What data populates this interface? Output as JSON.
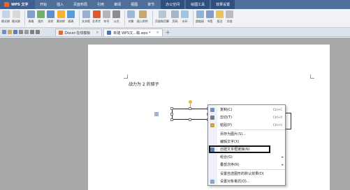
{
  "app": {
    "name": "WPS 文字"
  },
  "menu": [
    "开始",
    "插入",
    "页面布局",
    "引用",
    "审阅",
    "视图",
    "章节",
    "办公空间",
    "绘图工具",
    "效果设置"
  ],
  "menu_active_index": 7,
  "ribbon": {
    "group1": [
      "格式刷",
      "格式刷"
    ],
    "group2": [
      "表格",
      "图片",
      "形状",
      "素材库",
      "图表"
    ],
    "group3": [
      "文本框",
      "艺术字",
      "符号",
      "公式"
    ],
    "group4": [
      "对象",
      "插入附件"
    ],
    "group5": [
      "页眉和页脚",
      "页码",
      "水印"
    ],
    "group6": [
      "超链接",
      "书签",
      "批注",
      "文档"
    ]
  },
  "tabs": [
    {
      "label": "Docer-在线模板"
    },
    {
      "label": "新建 WPS文...稿.wps *"
    }
  ],
  "document": {
    "text": "战力为 2 的骑子"
  },
  "context_menu": {
    "items": [
      {
        "label": "复制(C)",
        "shortcut": "Ctrl+C"
      },
      {
        "label": "剪切(T)",
        "shortcut": "Ctrl+X"
      },
      {
        "label": "粘贴(P)",
        "shortcut": "Ctrl+V"
      },
      {
        "label": "另存为图片(S)..."
      },
      {
        "label": "编辑文字(X)"
      },
      {
        "label": "创建文本框链接(N)"
      },
      {
        "label": "组合(G)"
      },
      {
        "label": "叠放次序(R)"
      },
      {
        "label": "设置自选图形的默认效果(D)"
      },
      {
        "label": "设置对象格式(O)..."
      }
    ]
  },
  "colors": {
    "menubar": "#4f6f9b",
    "accent": "#e8682c"
  }
}
